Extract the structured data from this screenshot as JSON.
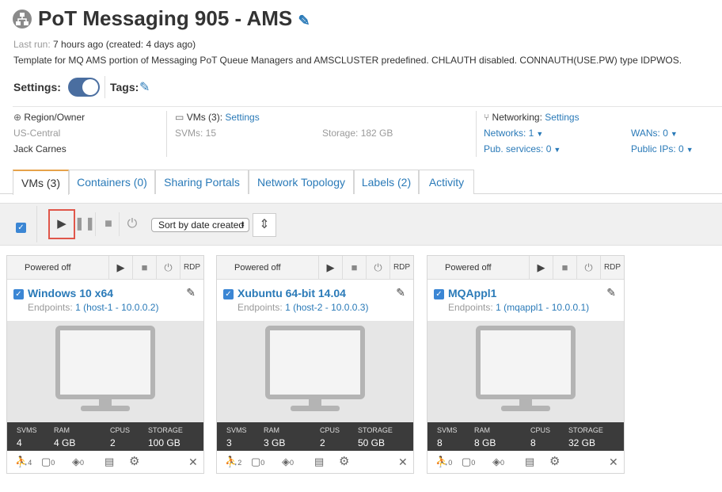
{
  "header": {
    "title": "PoT Messaging 905 - AMS",
    "last_run_label": "Last run:",
    "last_run_value": "7 hours ago (created: 4 days ago)",
    "description": "Template for MQ AMS portion of Messaging PoT Queue Managers and AMSCLUSTER predefined. CHLAUTH disabled. CONNAUTH(USE.PW) type IDPWOS.",
    "settings_label": "Settings:",
    "tags_label": "Tags:"
  },
  "info": {
    "region_label": "Region/Owner",
    "region": "US-Central",
    "owner": "Jack Carnes",
    "vms_label": "VMs (3):",
    "vms_settings": "Settings",
    "svms": "SVMs: 15",
    "storage": "Storage: 182 GB",
    "networking_label": "Networking:",
    "networking_settings": "Settings",
    "networks": "Networks: 1",
    "pub_services": "Pub. services: 0",
    "wans": "WANs: 0",
    "public_ips": "Public IPs: 0"
  },
  "tabs": [
    "VMs (3)",
    "Containers (0)",
    "Sharing Portals",
    "Network Topology",
    "Labels (2)",
    "Activity"
  ],
  "toolbar": {
    "sort_label": "Sort by date created"
  },
  "card_labels": {
    "powered_off": "Powered off",
    "rdp": "RDP",
    "endpoints": "Endpoints:",
    "svms": "SVMS",
    "ram": "RAM",
    "cpus": "CPUS",
    "storage": "STORAGE"
  },
  "vms": [
    {
      "name": "Windows 10 x64",
      "endpoint": "1 (host-1 - 10.0.0.2)",
      "svms": "4",
      "ram": "4 GB",
      "cpus": "2",
      "storage": "100 GB",
      "users": "4",
      "comments": "0",
      "tags": "0"
    },
    {
      "name": "Xubuntu 64-bit 14.04",
      "endpoint": "1 (host-2 - 10.0.0.3)",
      "svms": "3",
      "ram": "3 GB",
      "cpus": "2",
      "storage": "50 GB",
      "users": "2",
      "comments": "0",
      "tags": "0"
    },
    {
      "name": "MQAppl1",
      "endpoint": "1 (mqappl1 - 10.0.0.1)",
      "svms": "8",
      "ram": "8 GB",
      "cpus": "8",
      "storage": "32 GB",
      "users": "0",
      "comments": "0",
      "tags": "0"
    }
  ]
}
